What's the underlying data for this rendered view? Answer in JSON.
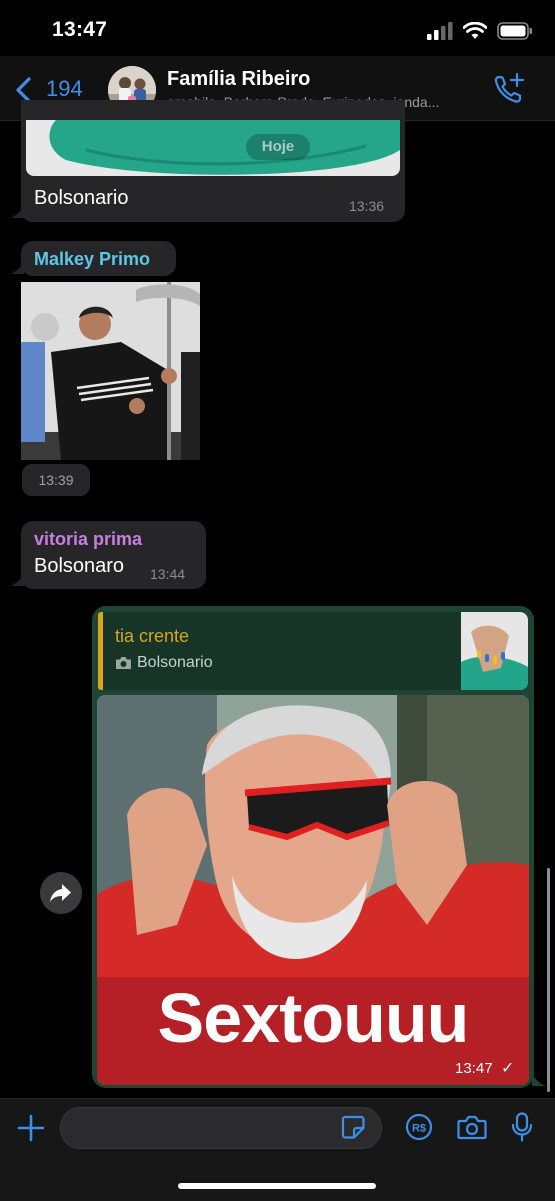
{
  "status_bar": {
    "time": "13:47"
  },
  "header": {
    "back_count": "194",
    "title": "Família Ribeiro",
    "members": "amabila, Barbara Prado, Euripedes, ianda..."
  },
  "messages": {
    "m1": {
      "date_pill": "Hoje",
      "text": "Bolsonario",
      "time": "13:36"
    },
    "m2": {
      "sender": "Malkey Primo",
      "sender_color": "#5ec6e8",
      "time": "13:39"
    },
    "m3": {
      "sender": "vitoria prima",
      "sender_color": "#c77ee0",
      "text": "Bolsonaro",
      "time": "13:44"
    },
    "m4": {
      "quote_sender": "tia crente",
      "quote_sender_color": "#d8a51d",
      "quote_text": "Bolsonario",
      "caption": "Sextouuu",
      "time": "13:47",
      "status": "✓"
    }
  },
  "colors": {
    "accent": "#3d8fe8",
    "outgoing_bubble": "#1e4436",
    "incoming_bubble": "#262628"
  },
  "icons": {
    "back": "chevron-left-icon",
    "call": "add-call-icon",
    "forward": "forward-icon",
    "attach": "plus-icon",
    "sticker": "sticker-icon",
    "payment": "payment-icon",
    "camera": "camera-icon",
    "mic": "microphone-icon"
  }
}
